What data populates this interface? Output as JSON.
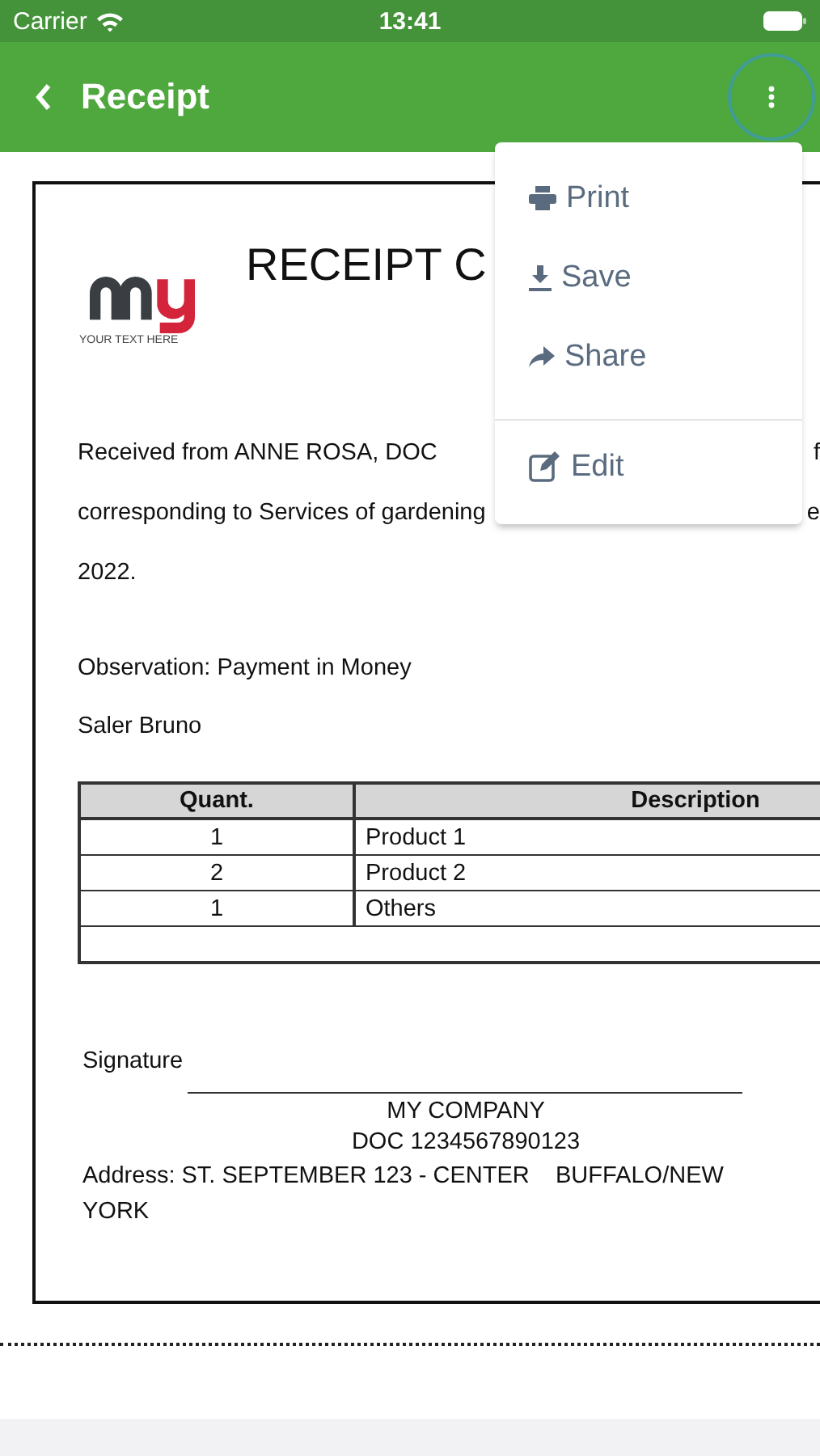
{
  "status_bar": {
    "carrier": "Carrier",
    "time": "13:41"
  },
  "nav_bar": {
    "title": "Receipt"
  },
  "document": {
    "title": "RECEIPT C",
    "logo_tagline": "YOUR TEXT HERE",
    "paragraph_lines": [
      {
        "text": "Received from ANNE ROSA, DOC",
        "tail": "f"
      },
      {
        "text": "corresponding to Services of gardening",
        "tail": "e"
      },
      {
        "text": "2022."
      }
    ],
    "observation": "Observation: Payment in Money",
    "saler": "Saler Bruno",
    "table": {
      "columns": [
        "Quant.",
        "Description"
      ],
      "rows": [
        [
          "1",
          "Product 1"
        ],
        [
          "2",
          "Product 2"
        ],
        [
          "1",
          "Others"
        ]
      ]
    },
    "signature_label": "Signature",
    "company": "MY COMPANY",
    "doc_number": "DOC 1234567890123",
    "address": "Address: ST. SEPTEMBER 123 - CENTER    BUFFALO/NEW YORK"
  },
  "menu": {
    "items": [
      {
        "kind": "print",
        "label": "Print"
      },
      {
        "kind": "save",
        "label": "Save"
      },
      {
        "kind": "share",
        "label": "Share"
      },
      {
        "kind": "edit",
        "label": "Edit"
      }
    ]
  }
}
